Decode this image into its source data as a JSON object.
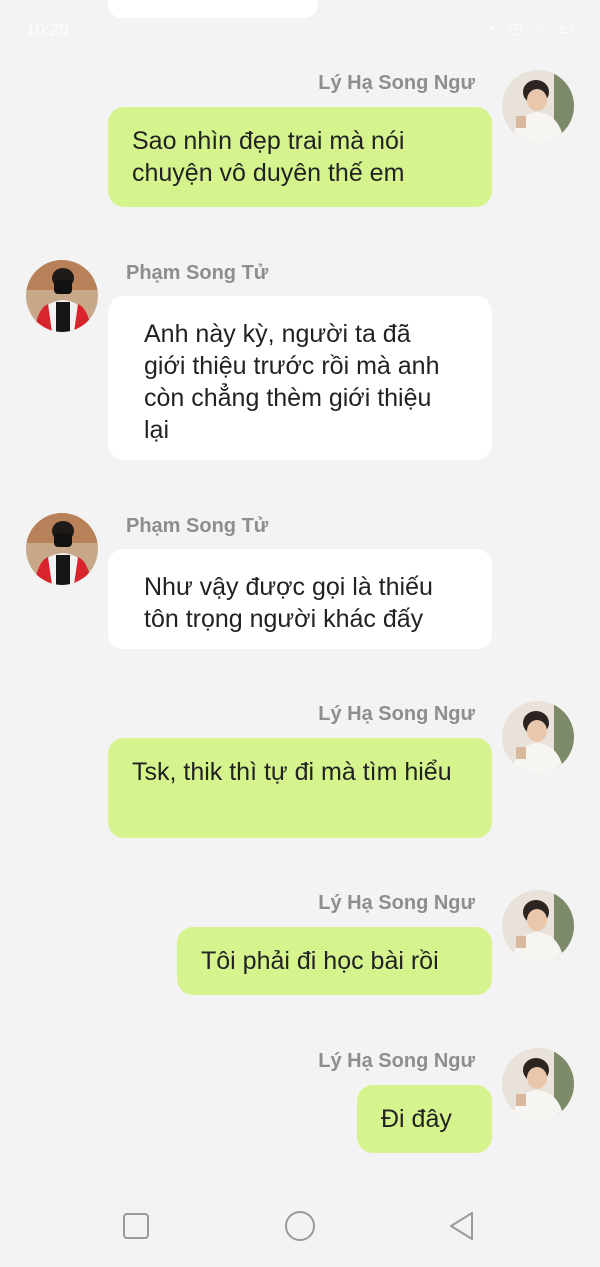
{
  "status_bar": {
    "time": "10:29",
    "icons": [
      "signal-icon",
      "wifi-icon",
      "alarm-icon",
      "mute-icon",
      "headphones-icon",
      "battery-icon"
    ]
  },
  "colors": {
    "outgoing_bubble": "#d6f48e",
    "incoming_bubble": "#ffffff",
    "background": "#f3f3f3",
    "sender_name": "#8e8e8e"
  },
  "messages": [
    {
      "sender": "Lý Hạ Song Ngư",
      "direction": "outgoing",
      "text": "Sao nhìn đẹp trai mà nói chuyện vô duyên thế em"
    },
    {
      "sender": "Phạm Song Tử",
      "direction": "incoming",
      "text": "Anh này kỳ, người ta đã giới thiệu trước rồi mà anh còn chẳng thèm giới thiệu lại"
    },
    {
      "sender": "Phạm Song Tử",
      "direction": "incoming",
      "text": "Như vậy được gọi là thiếu tôn trọng người khác đấy"
    },
    {
      "sender": "Lý Hạ Song Ngư",
      "direction": "outgoing",
      "text": "Tsk, thik thì tự đi mà tìm hiểu"
    },
    {
      "sender": "Lý Hạ Song Ngư",
      "direction": "outgoing",
      "text": "Tôi phải đi học bài rồi"
    },
    {
      "sender": "Lý Hạ Song Ngư",
      "direction": "outgoing",
      "text": "Đi đây"
    }
  ],
  "nav_bar": {
    "buttons": [
      "recent-apps-icon",
      "home-icon",
      "back-icon"
    ]
  }
}
